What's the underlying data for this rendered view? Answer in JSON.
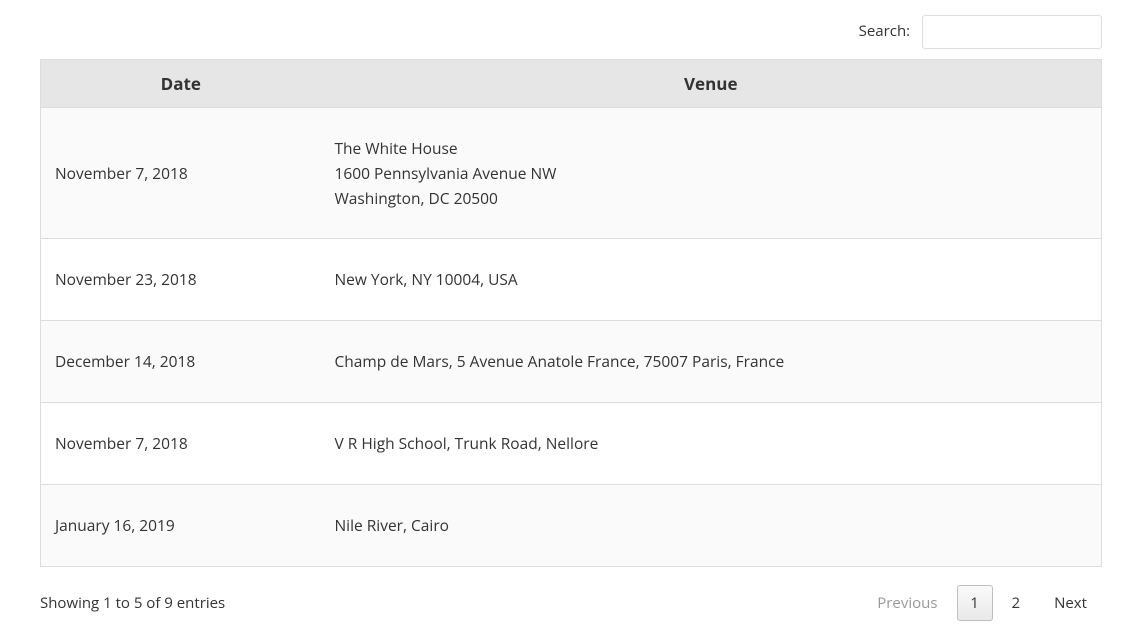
{
  "search": {
    "label": "Search:",
    "value": ""
  },
  "table": {
    "columns": [
      "Date",
      "Venue"
    ],
    "rows": [
      {
        "date": "November 7, 2018",
        "venue": "The White House\n1600 Pennsylvania Avenue NW\nWashington, DC 20500"
      },
      {
        "date": "November 23, 2018",
        "venue": "New York, NY 10004, USA"
      },
      {
        "date": "December 14, 2018",
        "venue": "Champ de Mars, 5 Avenue Anatole France, 75007 Paris, France"
      },
      {
        "date": "November 7, 2018",
        "venue": "V R High School, Trunk Road, Nellore"
      },
      {
        "date": "January 16, 2019",
        "venue": "Nile River, Cairo"
      }
    ]
  },
  "footer": {
    "info": "Showing 1 to 5 of 9 entries",
    "pagination": {
      "previous_label": "Previous",
      "next_label": "Next",
      "pages": [
        "1",
        "2"
      ],
      "current": "1"
    }
  }
}
